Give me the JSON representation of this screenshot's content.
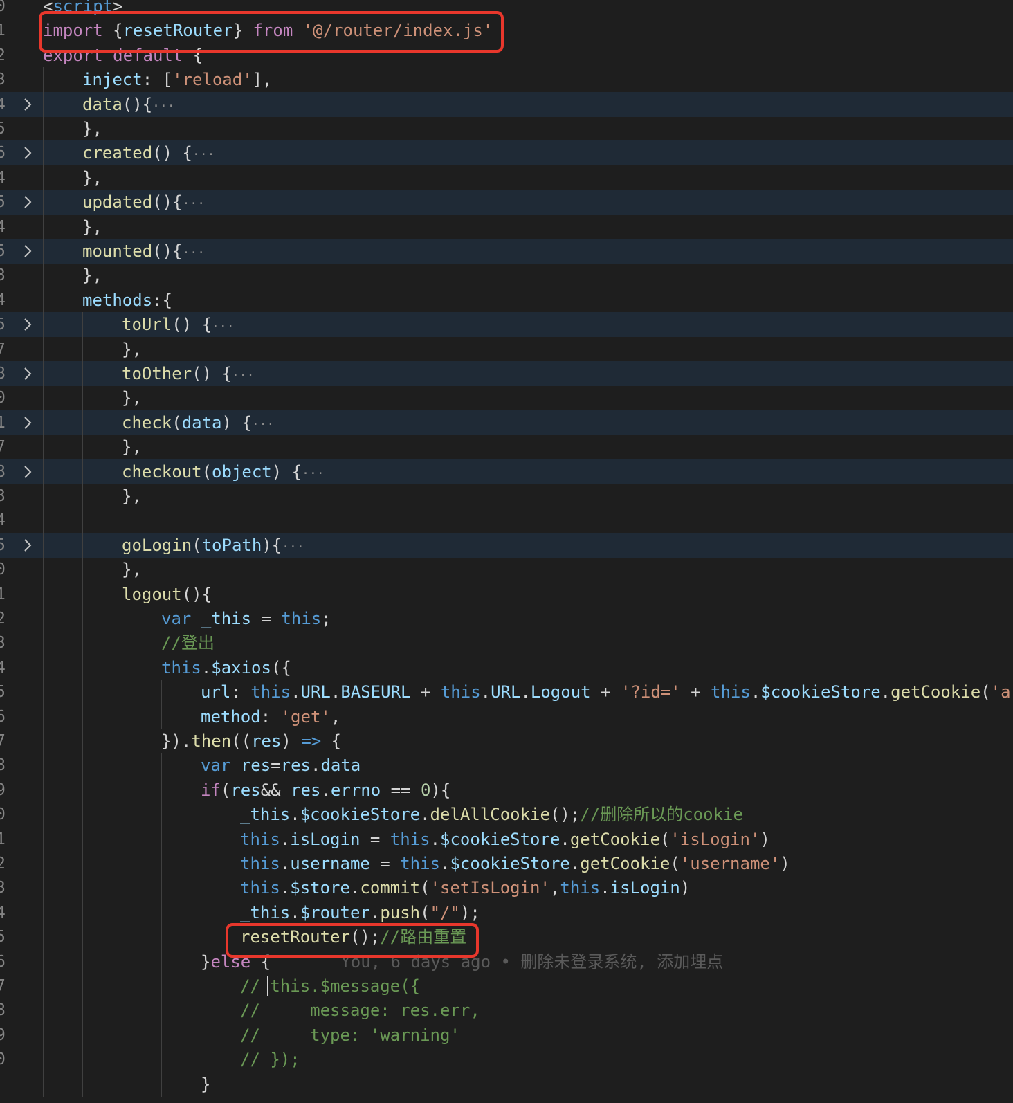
{
  "lines": [
    {
      "num": "0",
      "folded": false,
      "indent": 0,
      "tokens": [
        [
          "pu",
          "<"
        ],
        [
          "th",
          "script"
        ],
        [
          "pu",
          ">"
        ]
      ]
    },
    {
      "num": "1",
      "folded": false,
      "indent": 0,
      "tokens": [
        [
          "kw",
          "import"
        ],
        [
          "pu",
          " {"
        ],
        [
          "vr",
          "resetRouter"
        ],
        [
          "pu",
          "} "
        ],
        [
          "kw",
          "from"
        ],
        [
          "pu",
          " "
        ],
        [
          "st",
          "'@/router/index.js'"
        ]
      ]
    },
    {
      "num": "2",
      "folded": false,
      "indent": 0,
      "tokens": [
        [
          "kw",
          "export"
        ],
        [
          "pu",
          " "
        ],
        [
          "kw",
          "default"
        ],
        [
          "pu",
          " {"
        ]
      ]
    },
    {
      "num": "3",
      "folded": false,
      "indent": 1,
      "tokens": [
        [
          "vr",
          "inject"
        ],
        [
          "pu",
          ": ["
        ],
        [
          "st",
          "'reload'"
        ],
        [
          "pu",
          "],"
        ]
      ]
    },
    {
      "num": "4",
      "folded": true,
      "indent": 1,
      "tokens": [
        [
          "fn",
          "data"
        ],
        [
          "pu",
          "(){"
        ],
        [
          "el",
          "···"
        ]
      ]
    },
    {
      "num": "5",
      "folded": false,
      "indent": 1,
      "tokens": [
        [
          "pu",
          "},"
        ]
      ]
    },
    {
      "num": "6",
      "folded": true,
      "indent": 1,
      "tokens": [
        [
          "fn",
          "created"
        ],
        [
          "pu",
          "() {"
        ],
        [
          "el",
          "···"
        ]
      ]
    },
    {
      "num": "4",
      "folded": false,
      "indent": 1,
      "tokens": [
        [
          "pu",
          "},"
        ]
      ]
    },
    {
      "num": "5",
      "folded": true,
      "indent": 1,
      "tokens": [
        [
          "fn",
          "updated"
        ],
        [
          "pu",
          "(){"
        ],
        [
          "el",
          "···"
        ]
      ]
    },
    {
      "num": "4",
      "folded": false,
      "indent": 1,
      "tokens": [
        [
          "pu",
          "},"
        ]
      ]
    },
    {
      "num": "5",
      "folded": true,
      "indent": 1,
      "tokens": [
        [
          "fn",
          "mounted"
        ],
        [
          "pu",
          "(){"
        ],
        [
          "el",
          "···"
        ]
      ]
    },
    {
      "num": "3",
      "folded": false,
      "indent": 1,
      "tokens": [
        [
          "pu",
          "},"
        ]
      ]
    },
    {
      "num": "4",
      "folded": false,
      "indent": 1,
      "tokens": [
        [
          "vr",
          "methods"
        ],
        [
          "pu",
          ":{"
        ]
      ]
    },
    {
      "num": "5",
      "folded": true,
      "indent": 2,
      "tokens": [
        [
          "fn",
          "toUrl"
        ],
        [
          "pu",
          "() {"
        ],
        [
          "el",
          "···"
        ]
      ]
    },
    {
      "num": "7",
      "folded": false,
      "indent": 2,
      "tokens": [
        [
          "pu",
          "},"
        ]
      ]
    },
    {
      "num": "8",
      "folded": true,
      "indent": 2,
      "tokens": [
        [
          "fn",
          "toOther"
        ],
        [
          "pu",
          "() {"
        ],
        [
          "el",
          "···"
        ]
      ]
    },
    {
      "num": "0",
      "folded": false,
      "indent": 2,
      "tokens": [
        [
          "pu",
          "},"
        ]
      ]
    },
    {
      "num": "1",
      "folded": true,
      "indent": 2,
      "tokens": [
        [
          "fn",
          "check"
        ],
        [
          "pu",
          "("
        ],
        [
          "vr",
          "data"
        ],
        [
          "pu",
          ") {"
        ],
        [
          "el",
          "···"
        ]
      ]
    },
    {
      "num": "7",
      "folded": false,
      "indent": 2,
      "tokens": [
        [
          "pu",
          "},"
        ]
      ]
    },
    {
      "num": "8",
      "folded": true,
      "indent": 2,
      "tokens": [
        [
          "fn",
          "checkout"
        ],
        [
          "pu",
          "("
        ],
        [
          "vr",
          "object"
        ],
        [
          "pu",
          ") {"
        ],
        [
          "el",
          "···"
        ]
      ]
    },
    {
      "num": "3",
      "folded": false,
      "indent": 2,
      "tokens": [
        [
          "pu",
          "},"
        ]
      ]
    },
    {
      "num": "4",
      "folded": false,
      "indent": 2,
      "tokens": []
    },
    {
      "num": "5",
      "folded": true,
      "indent": 2,
      "tokens": [
        [
          "fn",
          "goLogin"
        ],
        [
          "pu",
          "("
        ],
        [
          "vr",
          "toPath"
        ],
        [
          "pu",
          "){"
        ],
        [
          "el",
          "···"
        ]
      ]
    },
    {
      "num": "0",
      "folded": false,
      "indent": 2,
      "tokens": [
        [
          "pu",
          "},"
        ]
      ]
    },
    {
      "num": "1",
      "folded": false,
      "indent": 2,
      "tokens": [
        [
          "fn",
          "logout"
        ],
        [
          "pu",
          "(){"
        ]
      ]
    },
    {
      "num": "2",
      "folded": false,
      "indent": 3,
      "tokens": [
        [
          "th",
          "var"
        ],
        [
          "pu",
          " "
        ],
        [
          "vr",
          "_this"
        ],
        [
          "pu",
          " = "
        ],
        [
          "th",
          "this"
        ],
        [
          "pu",
          ";"
        ]
      ]
    },
    {
      "num": "3",
      "folded": false,
      "indent": 3,
      "tokens": [
        [
          "cm",
          "//登出"
        ]
      ]
    },
    {
      "num": "4",
      "folded": false,
      "indent": 3,
      "tokens": [
        [
          "th",
          "this"
        ],
        [
          "pu",
          "."
        ],
        [
          "vr",
          "$axios"
        ],
        [
          "pu",
          "({"
        ]
      ]
    },
    {
      "num": "5",
      "folded": false,
      "indent": 4,
      "tokens": [
        [
          "vr",
          "url"
        ],
        [
          "pu",
          ": "
        ],
        [
          "th",
          "this"
        ],
        [
          "pu",
          "."
        ],
        [
          "vr",
          "URL"
        ],
        [
          "pu",
          "."
        ],
        [
          "vr",
          "BASEURL"
        ],
        [
          "pu",
          " + "
        ],
        [
          "th",
          "this"
        ],
        [
          "pu",
          "."
        ],
        [
          "vr",
          "URL"
        ],
        [
          "pu",
          "."
        ],
        [
          "vr",
          "Logout"
        ],
        [
          "pu",
          " + "
        ],
        [
          "st",
          "'?id='"
        ],
        [
          "pu",
          " + "
        ],
        [
          "th",
          "this"
        ],
        [
          "pu",
          "."
        ],
        [
          "vr",
          "$cookieStore"
        ],
        [
          "pu",
          "."
        ],
        [
          "fn",
          "getCookie"
        ],
        [
          "pu",
          "("
        ],
        [
          "st",
          "'a"
        ]
      ]
    },
    {
      "num": "6",
      "folded": false,
      "indent": 4,
      "tokens": [
        [
          "vr",
          "method"
        ],
        [
          "pu",
          ": "
        ],
        [
          "st",
          "'get'"
        ],
        [
          "pu",
          ","
        ]
      ]
    },
    {
      "num": "7",
      "folded": false,
      "indent": 3,
      "tokens": [
        [
          "pu",
          "})."
        ],
        [
          "fn",
          "then"
        ],
        [
          "pu",
          "(("
        ],
        [
          "vr",
          "res"
        ],
        [
          "pu",
          ") "
        ],
        [
          "th",
          "=>"
        ],
        [
          "pu",
          " {"
        ]
      ]
    },
    {
      "num": "8",
      "folded": false,
      "indent": 4,
      "tokens": [
        [
          "th",
          "var"
        ],
        [
          "pu",
          " "
        ],
        [
          "vr",
          "res"
        ],
        [
          "pu",
          "="
        ],
        [
          "vr",
          "res"
        ],
        [
          "pu",
          "."
        ],
        [
          "vr",
          "data"
        ]
      ]
    },
    {
      "num": "9",
      "folded": false,
      "indent": 4,
      "tokens": [
        [
          "kw",
          "if"
        ],
        [
          "pu",
          "("
        ],
        [
          "vr",
          "res"
        ],
        [
          "pu",
          "&& "
        ],
        [
          "vr",
          "res"
        ],
        [
          "pu",
          "."
        ],
        [
          "vr",
          "errno"
        ],
        [
          "pu",
          " == "
        ],
        [
          "nm",
          "0"
        ],
        [
          "pu",
          "){"
        ]
      ]
    },
    {
      "num": "0",
      "folded": false,
      "indent": 5,
      "tokens": [
        [
          "vr",
          "_this"
        ],
        [
          "pu",
          "."
        ],
        [
          "vr",
          "$cookieStore"
        ],
        [
          "pu",
          "."
        ],
        [
          "fn",
          "delAllCookie"
        ],
        [
          "pu",
          "();"
        ],
        [
          "cm",
          "//删除所以的cookie"
        ]
      ]
    },
    {
      "num": "1",
      "folded": false,
      "indent": 5,
      "tokens": [
        [
          "th",
          "this"
        ],
        [
          "pu",
          "."
        ],
        [
          "vr",
          "isLogin"
        ],
        [
          "pu",
          " = "
        ],
        [
          "th",
          "this"
        ],
        [
          "pu",
          "."
        ],
        [
          "vr",
          "$cookieStore"
        ],
        [
          "pu",
          "."
        ],
        [
          "fn",
          "getCookie"
        ],
        [
          "pu",
          "("
        ],
        [
          "st",
          "'isLogin'"
        ],
        [
          "pu",
          ")"
        ]
      ]
    },
    {
      "num": "2",
      "folded": false,
      "indent": 5,
      "tokens": [
        [
          "th",
          "this"
        ],
        [
          "pu",
          "."
        ],
        [
          "vr",
          "username"
        ],
        [
          "pu",
          " = "
        ],
        [
          "th",
          "this"
        ],
        [
          "pu",
          "."
        ],
        [
          "vr",
          "$cookieStore"
        ],
        [
          "pu",
          "."
        ],
        [
          "fn",
          "getCookie"
        ],
        [
          "pu",
          "("
        ],
        [
          "st",
          "'username'"
        ],
        [
          "pu",
          ")"
        ]
      ]
    },
    {
      "num": "3",
      "folded": false,
      "indent": 5,
      "tokens": [
        [
          "th",
          "this"
        ],
        [
          "pu",
          "."
        ],
        [
          "vr",
          "$store"
        ],
        [
          "pu",
          "."
        ],
        [
          "fn",
          "commit"
        ],
        [
          "pu",
          "("
        ],
        [
          "st",
          "'setIsLogin'"
        ],
        [
          "pu",
          ","
        ],
        [
          "th",
          "this"
        ],
        [
          "pu",
          "."
        ],
        [
          "vr",
          "isLogin"
        ],
        [
          "pu",
          ")"
        ]
      ]
    },
    {
      "num": "4",
      "folded": false,
      "indent": 5,
      "tokens": [
        [
          "vr",
          "_this"
        ],
        [
          "pu",
          "."
        ],
        [
          "vr",
          "$router"
        ],
        [
          "pu",
          "."
        ],
        [
          "fn",
          "push"
        ],
        [
          "pu",
          "("
        ],
        [
          "st",
          "\"/\""
        ],
        [
          "pu",
          ");"
        ]
      ]
    },
    {
      "num": "5",
      "folded": false,
      "indent": 5,
      "tokens": [
        [
          "fn",
          "resetRouter"
        ],
        [
          "pu",
          "();"
        ],
        [
          "cm",
          "//路由重置"
        ]
      ]
    },
    {
      "num": "6",
      "folded": false,
      "indent": 4,
      "tokens": [
        [
          "pu",
          "}"
        ],
        [
          "kw",
          "else"
        ],
        [
          "pu",
          " {"
        ],
        [
          "blame",
          "       You, 6 days ago • 删除未登录系统, 添加埋点"
        ]
      ]
    },
    {
      "num": "7",
      "folded": false,
      "indent": 5,
      "tokens": [
        [
          "cm",
          "// this.$message({"
        ]
      ]
    },
    {
      "num": "8",
      "folded": false,
      "indent": 5,
      "tokens": [
        [
          "cm",
          "//     message: res.err,"
        ]
      ]
    },
    {
      "num": "9",
      "folded": false,
      "indent": 5,
      "tokens": [
        [
          "cm",
          "//     type: 'warning'"
        ]
      ]
    },
    {
      "num": "0",
      "folded": false,
      "indent": 5,
      "tokens": [
        [
          "cm",
          "// });"
        ]
      ]
    },
    {
      "num": "",
      "folded": false,
      "indent": 4,
      "tokens": [
        [
          "pu",
          "}"
        ]
      ]
    }
  ],
  "colors": {
    "highlight_box": "#e8372c",
    "background": "#1e1e1e",
    "folded_line_bg": "#1f2a36"
  }
}
